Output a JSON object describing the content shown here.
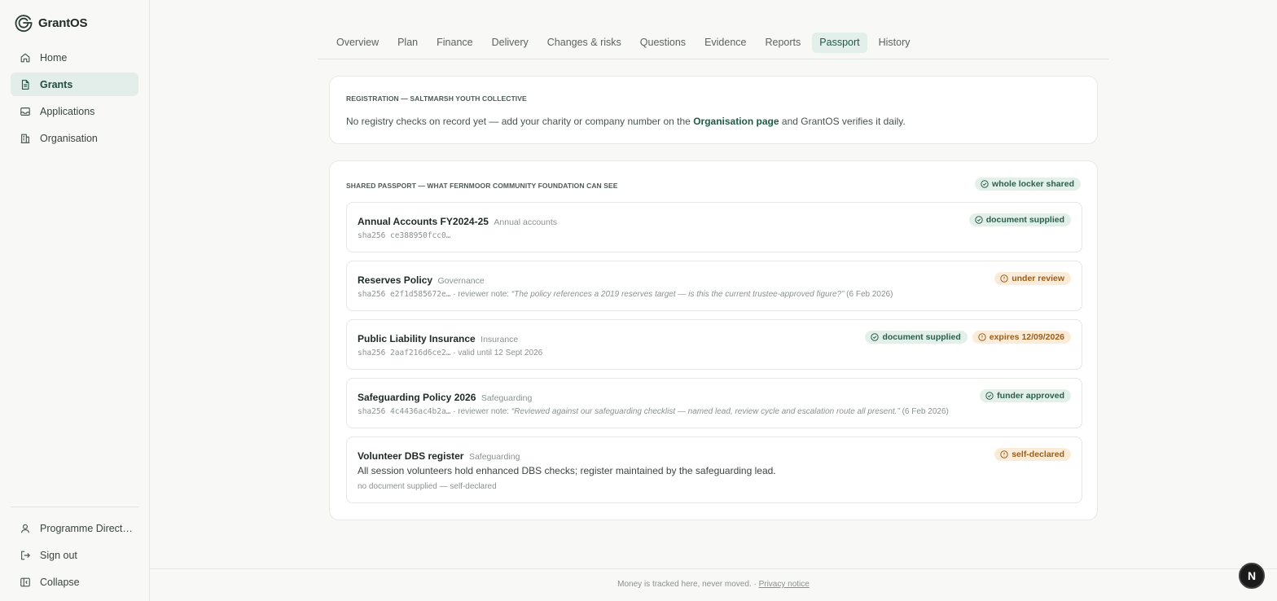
{
  "brand": {
    "name": "GrantOS",
    "logo_icon": "grantos-logo-icon"
  },
  "sidebar": {
    "items": [
      {
        "label": "Home",
        "icon": "home-icon"
      },
      {
        "label": "Grants",
        "icon": "document-icon",
        "active": true
      },
      {
        "label": "Applications",
        "icon": "inbox-icon"
      },
      {
        "label": "Organisation",
        "icon": "building-icon"
      }
    ],
    "bottom": [
      {
        "label": "Programme Direct…",
        "icon": "user-icon"
      },
      {
        "label": "Sign out",
        "icon": "sign-out-icon"
      },
      {
        "label": "Collapse",
        "icon": "sidebar-collapse-icon"
      }
    ]
  },
  "tabs": [
    "Overview",
    "Plan",
    "Finance",
    "Delivery",
    "Changes & risks",
    "Questions",
    "Evidence",
    "Reports",
    "Passport",
    "History"
  ],
  "active_tab": "Passport",
  "registration": {
    "title": "REGISTRATION — SALTMARSH YOUTH COLLECTIVE",
    "text_before": "No registry checks on record yet — add your charity or company number on the ",
    "link": "Organisation page",
    "text_after": " and GrantOS verifies it daily."
  },
  "passport": {
    "title": "SHARED PASSPORT — WHAT FERNMOOR COMMUNITY FOUNDATION CAN SEE",
    "badge": "whole locker shared",
    "items": [
      {
        "name": "Annual Accounts FY2024-25",
        "category": "Annual accounts",
        "hash": "sha256  ce388950fcc0…",
        "meta_suffix": "",
        "badges": [
          {
            "label": "document supplied",
            "tone": "green"
          }
        ]
      },
      {
        "name": "Reserves Policy",
        "category": "Governance",
        "hash": "sha256  e2f1d585672e…",
        "meta_prefix": " · reviewer note: ",
        "note": "“The policy references a 2019 reserves target — is this the current trustee-approved figure?”",
        "meta_suffix": " (6 Feb 2026)",
        "badges": [
          {
            "label": "under review",
            "tone": "amber"
          }
        ]
      },
      {
        "name": "Public Liability Insurance",
        "category": "Insurance",
        "hash": "sha256  2aaf216d6ce2…",
        "meta_suffix": " · valid until 12 Sept 2026",
        "badges": [
          {
            "label": "document supplied",
            "tone": "green"
          },
          {
            "label": "expires 12/09/2026",
            "tone": "amber"
          }
        ]
      },
      {
        "name": "Safeguarding Policy 2026",
        "category": "Safeguarding",
        "hash": "sha256  4c4436ac4b2a…",
        "meta_prefix": " · reviewer note: ",
        "note": "“Reviewed against our safeguarding checklist — named lead, review cycle and escalation route all present.”",
        "meta_suffix": " (6 Feb 2026)",
        "badges": [
          {
            "label": "funder approved",
            "tone": "green"
          }
        ]
      },
      {
        "name": "Volunteer DBS register",
        "category": "Safeguarding",
        "description": "All session volunteers hold enhanced DBS checks; register maintained by the safeguarding lead.",
        "meta_text": "no document supplied — self-declared",
        "badges": [
          {
            "label": "self-declared",
            "tone": "amber"
          }
        ]
      }
    ]
  },
  "footer": {
    "text": "Money is tracked here, never moved. · ",
    "link": "Privacy notice"
  },
  "fab": {
    "label": "N"
  },
  "colors": {
    "accent": "#1e5a47",
    "green_badge_bg": "#e3efe9",
    "amber_badge_bg": "#fbecd9",
    "amber_text": "#9a5d1c"
  }
}
